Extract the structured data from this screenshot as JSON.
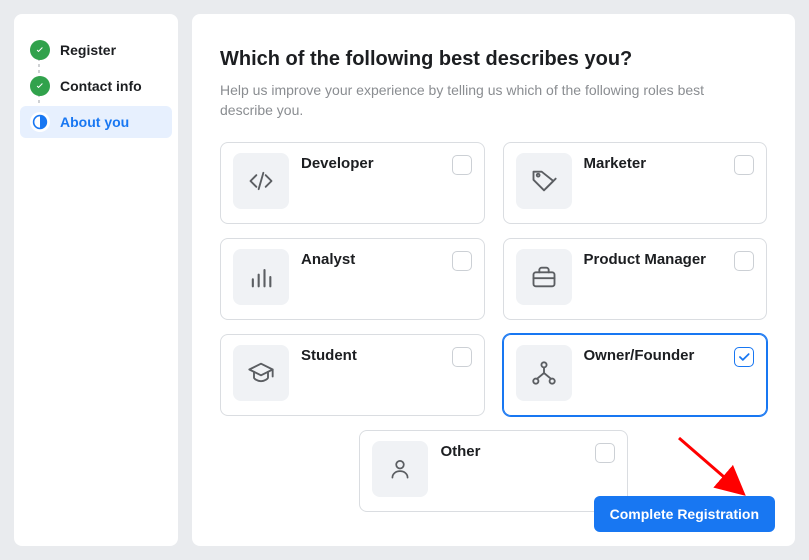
{
  "sidebar": {
    "steps": [
      {
        "label": "Register",
        "state": "done"
      },
      {
        "label": "Contact info",
        "state": "done"
      },
      {
        "label": "About you",
        "state": "active"
      }
    ]
  },
  "main": {
    "title": "Which of the following best describes you?",
    "subtitle": "Help us improve your experience by telling us which of the following roles best describe you."
  },
  "roles": [
    {
      "key": "developer",
      "label": "Developer",
      "icon": "code-icon",
      "selected": false
    },
    {
      "key": "marketer",
      "label": "Marketer",
      "icon": "tag-icon",
      "selected": false
    },
    {
      "key": "analyst",
      "label": "Analyst",
      "icon": "bar-chart-icon",
      "selected": false
    },
    {
      "key": "product-manager",
      "label": "Product Manager",
      "icon": "briefcase-icon",
      "selected": false
    },
    {
      "key": "student",
      "label": "Student",
      "icon": "graduation-cap-icon",
      "selected": false
    },
    {
      "key": "owner-founder",
      "label": "Owner/Founder",
      "icon": "org-tree-icon",
      "selected": true
    },
    {
      "key": "other",
      "label": "Other",
      "icon": "person-icon",
      "selected": false
    }
  ],
  "actions": {
    "complete_label": "Complete Registration"
  },
  "colors": {
    "primary": "#1877f2",
    "success": "#31a24c"
  }
}
